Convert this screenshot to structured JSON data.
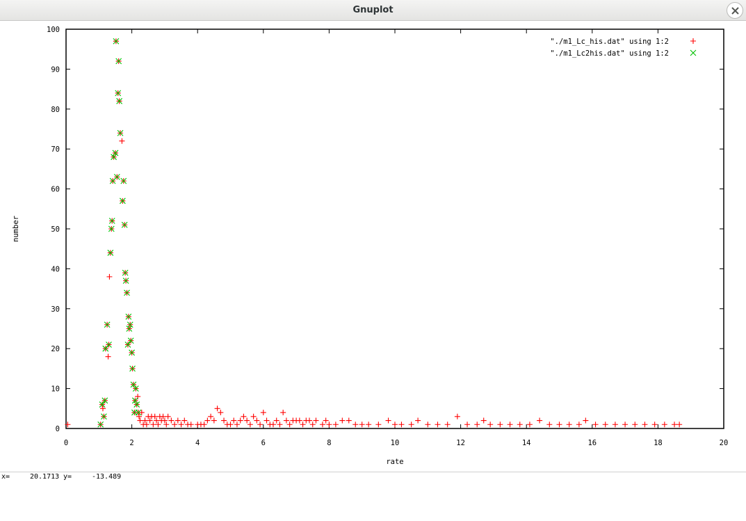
{
  "window": {
    "title": "Gnuplot",
    "close_icon": "close-icon"
  },
  "status": {
    "x_label": "x=",
    "x_value": "20.1713",
    "y_label": "y=",
    "y_value": "-13.489"
  },
  "chart_data": {
    "type": "scatter",
    "xlabel": "rate",
    "ylabel": "number",
    "xlim": [
      0,
      20
    ],
    "ylim": [
      0,
      100
    ],
    "xticks": [
      0,
      2,
      4,
      6,
      8,
      10,
      12,
      14,
      16,
      18,
      20
    ],
    "yticks": [
      0,
      10,
      20,
      30,
      40,
      50,
      60,
      70,
      80,
      90,
      100
    ],
    "legend_position": "top-right",
    "series": [
      {
        "name": "\"./m1_Lc_his.dat\" using 1:2",
        "marker": "plus",
        "color": "#ff0000",
        "points": [
          [
            0.05,
            1
          ],
          [
            1.05,
            1
          ],
          [
            1.1,
            6
          ],
          [
            1.12,
            5
          ],
          [
            1.15,
            3
          ],
          [
            1.18,
            7
          ],
          [
            1.2,
            20
          ],
          [
            1.25,
            26
          ],
          [
            1.28,
            18
          ],
          [
            1.3,
            21
          ],
          [
            1.32,
            38
          ],
          [
            1.35,
            44
          ],
          [
            1.38,
            50
          ],
          [
            1.4,
            52
          ],
          [
            1.42,
            62
          ],
          [
            1.45,
            68
          ],
          [
            1.5,
            69
          ],
          [
            1.52,
            97
          ],
          [
            1.55,
            63
          ],
          [
            1.58,
            84
          ],
          [
            1.6,
            92
          ],
          [
            1.62,
            82
          ],
          [
            1.65,
            74
          ],
          [
            1.7,
            72
          ],
          [
            1.72,
            57
          ],
          [
            1.75,
            62
          ],
          [
            1.78,
            51
          ],
          [
            1.8,
            39
          ],
          [
            1.82,
            37
          ],
          [
            1.85,
            34
          ],
          [
            1.88,
            21
          ],
          [
            1.9,
            28
          ],
          [
            1.92,
            25
          ],
          [
            1.95,
            26
          ],
          [
            1.97,
            22
          ],
          [
            2.0,
            19
          ],
          [
            2.02,
            15
          ],
          [
            2.05,
            11
          ],
          [
            2.08,
            4
          ],
          [
            2.1,
            7
          ],
          [
            2.12,
            10
          ],
          [
            2.15,
            6
          ],
          [
            2.18,
            8
          ],
          [
            2.2,
            4
          ],
          [
            2.22,
            3
          ],
          [
            2.25,
            2
          ],
          [
            2.3,
            4
          ],
          [
            2.35,
            1
          ],
          [
            2.4,
            2
          ],
          [
            2.45,
            1
          ],
          [
            2.5,
            3
          ],
          [
            2.55,
            2
          ],
          [
            2.6,
            3
          ],
          [
            2.65,
            1
          ],
          [
            2.7,
            3
          ],
          [
            2.75,
            2
          ],
          [
            2.8,
            1
          ],
          [
            2.85,
            3
          ],
          [
            2.9,
            2
          ],
          [
            2.95,
            3
          ],
          [
            3.0,
            2
          ],
          [
            3.05,
            1
          ],
          [
            3.1,
            3
          ],
          [
            3.2,
            2
          ],
          [
            3.3,
            1
          ],
          [
            3.4,
            2
          ],
          [
            3.5,
            1
          ],
          [
            3.6,
            2
          ],
          [
            3.7,
            1
          ],
          [
            3.8,
            1
          ],
          [
            4.0,
            1
          ],
          [
            4.1,
            1
          ],
          [
            4.2,
            1
          ],
          [
            4.3,
            2
          ],
          [
            4.4,
            3
          ],
          [
            4.5,
            2
          ],
          [
            4.6,
            5
          ],
          [
            4.7,
            4
          ],
          [
            4.8,
            2
          ],
          [
            4.9,
            1
          ],
          [
            5.0,
            1
          ],
          [
            5.1,
            2
          ],
          [
            5.2,
            1
          ],
          [
            5.3,
            2
          ],
          [
            5.4,
            3
          ],
          [
            5.5,
            2
          ],
          [
            5.6,
            1
          ],
          [
            5.7,
            3
          ],
          [
            5.8,
            2
          ],
          [
            5.9,
            1
          ],
          [
            6.0,
            4
          ],
          [
            6.1,
            2
          ],
          [
            6.2,
            1
          ],
          [
            6.3,
            1
          ],
          [
            6.4,
            2
          ],
          [
            6.5,
            1
          ],
          [
            6.6,
            4
          ],
          [
            6.7,
            2
          ],
          [
            6.8,
            1
          ],
          [
            6.9,
            2
          ],
          [
            7.0,
            2
          ],
          [
            7.1,
            2
          ],
          [
            7.2,
            1
          ],
          [
            7.3,
            2
          ],
          [
            7.4,
            2
          ],
          [
            7.5,
            1
          ],
          [
            7.6,
            2
          ],
          [
            7.8,
            1
          ],
          [
            7.9,
            2
          ],
          [
            8.0,
            1
          ],
          [
            8.2,
            1
          ],
          [
            8.4,
            2
          ],
          [
            8.6,
            2
          ],
          [
            8.8,
            1
          ],
          [
            9.0,
            1
          ],
          [
            9.2,
            1
          ],
          [
            9.5,
            1
          ],
          [
            9.8,
            2
          ],
          [
            10.0,
            1
          ],
          [
            10.2,
            1
          ],
          [
            10.5,
            1
          ],
          [
            10.7,
            2
          ],
          [
            11.0,
            1
          ],
          [
            11.3,
            1
          ],
          [
            11.6,
            1
          ],
          [
            11.9,
            3
          ],
          [
            12.2,
            1
          ],
          [
            12.5,
            1
          ],
          [
            12.7,
            2
          ],
          [
            12.9,
            1
          ],
          [
            13.2,
            1
          ],
          [
            13.5,
            1
          ],
          [
            13.8,
            1
          ],
          [
            14.1,
            1
          ],
          [
            14.4,
            2
          ],
          [
            14.7,
            1
          ],
          [
            15.0,
            1
          ],
          [
            15.3,
            1
          ],
          [
            15.6,
            1
          ],
          [
            15.8,
            2
          ],
          [
            16.1,
            1
          ],
          [
            16.4,
            1
          ],
          [
            16.7,
            1
          ],
          [
            17.0,
            1
          ],
          [
            17.3,
            1
          ],
          [
            17.6,
            1
          ],
          [
            17.9,
            1
          ],
          [
            18.2,
            1
          ],
          [
            18.5,
            1
          ],
          [
            18.65,
            1
          ]
        ]
      },
      {
        "name": "\"./m1_Lc2his.dat\" using 1:2",
        "marker": "cross",
        "color": "#00c000",
        "points": [
          [
            1.05,
            1
          ],
          [
            1.1,
            6
          ],
          [
            1.15,
            3
          ],
          [
            1.18,
            7
          ],
          [
            1.2,
            20
          ],
          [
            1.25,
            26
          ],
          [
            1.3,
            21
          ],
          [
            1.35,
            44
          ],
          [
            1.38,
            50
          ],
          [
            1.4,
            52
          ],
          [
            1.42,
            62
          ],
          [
            1.45,
            68
          ],
          [
            1.5,
            69
          ],
          [
            1.52,
            97
          ],
          [
            1.55,
            63
          ],
          [
            1.58,
            84
          ],
          [
            1.6,
            92
          ],
          [
            1.62,
            82
          ],
          [
            1.65,
            74
          ],
          [
            1.72,
            57
          ],
          [
            1.75,
            62
          ],
          [
            1.78,
            51
          ],
          [
            1.8,
            39
          ],
          [
            1.82,
            37
          ],
          [
            1.85,
            34
          ],
          [
            1.88,
            21
          ],
          [
            1.9,
            28
          ],
          [
            1.92,
            25
          ],
          [
            1.95,
            26
          ],
          [
            1.97,
            22
          ],
          [
            2.0,
            19
          ],
          [
            2.02,
            15
          ],
          [
            2.05,
            11
          ],
          [
            2.08,
            4
          ],
          [
            2.1,
            7
          ],
          [
            2.12,
            10
          ],
          [
            2.15,
            6
          ],
          [
            2.2,
            4
          ]
        ]
      }
    ]
  }
}
